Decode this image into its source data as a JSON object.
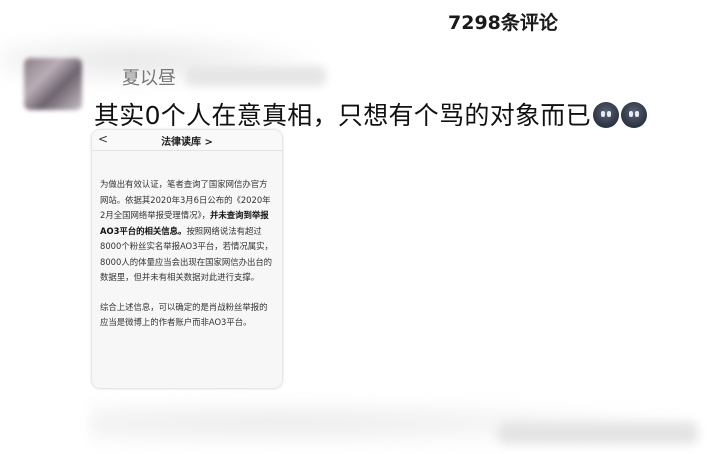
{
  "header": {
    "comment_count": "7298条评论"
  },
  "comment": {
    "username": "夏以昼",
    "text": "其实0个人在意真相，只想有个骂的对象而已",
    "emoji": [
      "dark-face-emoji",
      "dark-face-emoji"
    ]
  },
  "screenshot": {
    "back_label": "<",
    "title": "法律读库 >",
    "para1_normal_1": "为做出有效认证，笔者查询了国家网信办官方网站。依据其2020年3月6日公布的《2020年2月全国网络举报受理情况》，",
    "para1_bold": "并未查询到举报AO3平台的相关信息。",
    "para1_normal_2": "按照网络说法有超过8000个粉丝实名举报AO3平台，若情况属实，8000人的体量应当会出现在国家网信办出台的数据里，但并未有相关数据对此进行支撑。",
    "para2_normal": "综合上述信息，可以确定的是肖战粉丝举报的应当是微博上的作者账户而非AO3平台。"
  }
}
